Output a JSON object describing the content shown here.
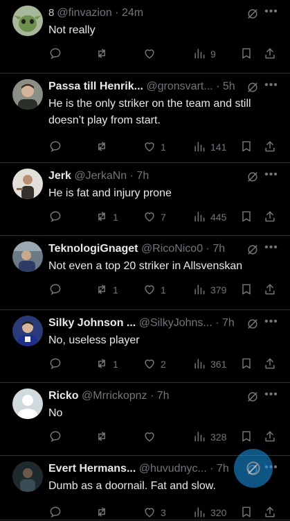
{
  "posts": [
    {
      "name": "",
      "handle": "@finvazion",
      "time": "24m",
      "badge": "8",
      "text": "Not really",
      "replies": "",
      "reposts": "",
      "likes": "",
      "views": "9"
    },
    {
      "name": "Passa till Henrik...",
      "handle": "@gronsvart...",
      "time": "5h",
      "badge": "",
      "text": "He is the only striker on the team and still doesn’t play from start.",
      "replies": "",
      "reposts": "",
      "likes": "1",
      "views": "141"
    },
    {
      "name": "Jerk",
      "handle": "@JerkaNn",
      "time": "7h",
      "badge": "",
      "text": "He is fat and injury prone",
      "replies": "",
      "reposts": "1",
      "likes": "7",
      "views": "445"
    },
    {
      "name": "TeknologiGnaget",
      "handle": "@RicoNico0",
      "time": "7h",
      "badge": "",
      "text": "Not even a top 20 striker in Allsvenskan",
      "replies": "",
      "reposts": "1",
      "likes": "1",
      "views": "379"
    },
    {
      "name": "Silky Johnson ...",
      "handle": "@SilkyJohns...",
      "time": "7h",
      "badge": "",
      "text": "No, useless player",
      "replies": "",
      "reposts": "1",
      "likes": "2",
      "views": "361"
    },
    {
      "name": "Ricko",
      "handle": "@Mrrickopnz",
      "time": "7h",
      "badge": "",
      "text": "No",
      "replies": "",
      "reposts": "",
      "likes": "",
      "views": "328"
    },
    {
      "name": "Evert Hermans...",
      "handle": "@huvudnyc...",
      "time": "7h",
      "badge": "",
      "text": "Dumb as a doornail. Fat and slow.",
      "replies": "",
      "reposts": "",
      "likes": "3",
      "views": "320"
    }
  ],
  "icons": {
    "reply": "reply-icon",
    "repost": "repost-icon",
    "like": "heart-icon",
    "views": "views-icon",
    "bookmark": "bookmark-icon",
    "share": "share-icon",
    "grok": "grok-icon",
    "more": "more-icon",
    "fab": "compose-icon"
  },
  "colors": {
    "accent": "#1d9bf0",
    "muted": "#71767b",
    "text": "#e7e9ea",
    "background": "#000000"
  }
}
